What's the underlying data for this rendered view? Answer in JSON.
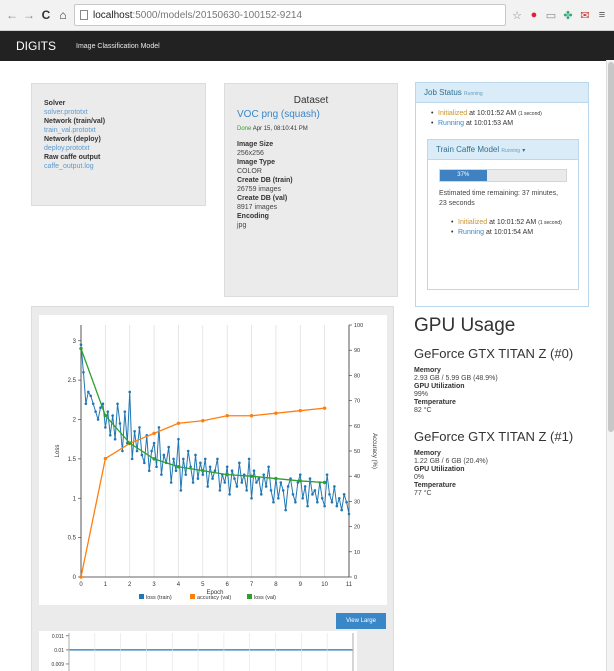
{
  "browser": {
    "url_host": "localhost",
    "url_path": ":5000/models/20150630-100152-9214",
    "back_icon": "back-arrow",
    "forward_icon": "forward-arrow",
    "reload_icon": "reload",
    "home_icon": "home"
  },
  "navbar": {
    "brand": "DIGITS",
    "crumb": "Image Classification Model"
  },
  "model_info": {
    "solver_label": "Solver",
    "solver_file": "solver.prototxt",
    "net_train_label": "Network (train/val)",
    "net_train_file": "train_val.prototxt",
    "net_deploy_label": "Network (deploy)",
    "net_deploy_file": "deploy.prototxt",
    "raw_label": "Raw caffe output",
    "raw_file": "caffe_output.log"
  },
  "dataset": {
    "heading": "Dataset",
    "name": "VOC png (squash)",
    "done_label": "Done",
    "done_time": "Apr 15, 08:10:41 PM",
    "image_size_label": "Image Size",
    "image_size": "256x256",
    "image_type_label": "Image Type",
    "image_type": "COLOR",
    "db_train_label": "Create DB (train)",
    "db_train": "26759 images",
    "db_val_label": "Create DB (val)",
    "db_val": "8917 images",
    "encoding_label": "Encoding",
    "encoding": "jpg"
  },
  "job_status": {
    "title": "Job Status",
    "state": "Running",
    "events": [
      {
        "status": "Initialized",
        "time": "at 10:01:52 AM",
        "note": "(1 second)"
      },
      {
        "status": "Running",
        "time": "at 10:01:53 AM",
        "note": ""
      }
    ],
    "model_title": "Train Caffe Model",
    "model_state": "Running",
    "progress_percent": 37,
    "progress_label": "37%",
    "estimate": "Estimated time remaining: 37 minutes, 23 seconds",
    "model_events": [
      {
        "status": "Initialized",
        "time": "at 10:01:52 AM",
        "note": "(1 second)"
      },
      {
        "status": "Running",
        "time": "at 10:01:54 AM",
        "note": ""
      }
    ]
  },
  "gpu": {
    "heading": "GPU Usage",
    "devices": [
      {
        "name": "GeForce GTX TITAN Z (#0)",
        "memory_label": "Memory",
        "memory": "2.93 GB / 5.99 GB (48.9%)",
        "util_label": "GPU Utilization",
        "util": "99%",
        "temp_label": "Temperature",
        "temp": "82 °C"
      },
      {
        "name": "GeForce GTX TITAN Z (#1)",
        "memory_label": "Memory",
        "memory": "1.22 GB / 6 GB (20.4%)",
        "util_label": "GPU Utilization",
        "util": "0%",
        "temp_label": "Temperature",
        "temp": "77 °C"
      }
    ]
  },
  "view_large_label": "View Large",
  "colors": {
    "loss_train": "#1f77b4",
    "accuracy_val": "#ff7f0e",
    "loss_val": "#2ca02c",
    "accent": "#3a87c8"
  },
  "chart_data": [
    {
      "type": "line",
      "xlabel": "Epoch",
      "ylabel": "Loss",
      "y2label": "Accuracy (%)",
      "xlim": [
        0,
        11
      ],
      "ylim": [
        0,
        3.2
      ],
      "y2lim": [
        0,
        100
      ],
      "xticks": [
        0,
        1,
        2,
        3,
        4,
        5,
        6,
        7,
        8,
        9,
        10,
        11
      ],
      "yticks": [
        0,
        0.5,
        1,
        1.5,
        2,
        2.5,
        3
      ],
      "y2ticks": [
        0,
        10,
        20,
        30,
        40,
        50,
        60,
        70,
        80,
        90,
        100
      ],
      "legend": "bottom",
      "series": [
        {
          "name": "loss (train)",
          "axis": "y",
          "color": "#1f77b4",
          "x": [
            0,
            0.1,
            0.2,
            0.3,
            0.4,
            0.5,
            0.6,
            0.7,
            0.8,
            0.9,
            1.0,
            1.1,
            1.2,
            1.3,
            1.4,
            1.5,
            1.6,
            1.7,
            1.8,
            1.9,
            2.0,
            2.1,
            2.2,
            2.3,
            2.4,
            2.5,
            2.6,
            2.7,
            2.8,
            2.9,
            3.0,
            3.1,
            3.2,
            3.3,
            3.4,
            3.5,
            3.6,
            3.7,
            3.8,
            3.9,
            4.0,
            4.1,
            4.2,
            4.3,
            4.4,
            4.5,
            4.6,
            4.7,
            4.8,
            4.9,
            5.0,
            5.1,
            5.2,
            5.3,
            5.4,
            5.5,
            5.6,
            5.7,
            5.8,
            5.9,
            6.0,
            6.1,
            6.2,
            6.3,
            6.4,
            6.5,
            6.6,
            6.7,
            6.8,
            6.9,
            7.0,
            7.1,
            7.2,
            7.3,
            7.4,
            7.5,
            7.6,
            7.7,
            7.8,
            7.9,
            8.0,
            8.1,
            8.2,
            8.3,
            8.4,
            8.5,
            8.6,
            8.7,
            8.8,
            8.9,
            9.0,
            9.1,
            9.2,
            9.3,
            9.4,
            9.5,
            9.6,
            9.7,
            9.8,
            9.9,
            10.0,
            10.1,
            10.2,
            10.3,
            10.4,
            10.5,
            10.6,
            10.7,
            10.8,
            10.9,
            11.0
          ],
          "y": [
            2.95,
            2.6,
            2.2,
            2.35,
            2.3,
            2.2,
            2.1,
            2.0,
            2.15,
            2.2,
            1.9,
            2.1,
            1.8,
            2.05,
            1.75,
            2.2,
            1.95,
            1.6,
            2.1,
            1.7,
            2.35,
            1.5,
            1.85,
            1.6,
            1.9,
            1.55,
            1.45,
            1.8,
            1.35,
            1.6,
            1.7,
            1.4,
            1.9,
            1.3,
            1.55,
            1.45,
            1.65,
            1.2,
            1.5,
            1.35,
            1.75,
            1.1,
            1.5,
            1.3,
            1.6,
            1.4,
            1.2,
            1.55,
            1.25,
            1.45,
            1.3,
            1.5,
            1.15,
            1.4,
            1.25,
            1.35,
            1.5,
            1.1,
            1.3,
            1.2,
            1.4,
            1.05,
            1.35,
            1.25,
            1.15,
            1.45,
            1.2,
            1.3,
            1.1,
            1.5,
            1.0,
            1.35,
            1.2,
            1.25,
            1.05,
            1.3,
            1.15,
            1.4,
            1.1,
            0.95,
            1.25,
            1.0,
            1.2,
            1.1,
            0.85,
            1.15,
            1.25,
            1.05,
            0.95,
            1.2,
            1.3,
            1.0,
            1.15,
            0.9,
            1.25,
            1.05,
            1.1,
            0.95,
            1.2,
            1.0,
            0.9,
            1.3,
            1.05,
            0.95,
            1.15,
            0.9,
            1.0,
            0.85,
            1.05,
            0.95,
            0.8
          ]
        },
        {
          "name": "accuracy (val)",
          "axis": "y2",
          "color": "#ff7f0e",
          "x": [
            0,
            1,
            2,
            3,
            4,
            5,
            6,
            7,
            8,
            9,
            10
          ],
          "y": [
            0,
            47,
            53,
            57,
            61,
            62,
            64,
            64,
            65,
            66,
            67
          ]
        },
        {
          "name": "loss (val)",
          "axis": "y",
          "color": "#2ca02c",
          "x": [
            0,
            1,
            2,
            3,
            4,
            5,
            6,
            7,
            8,
            9,
            10
          ],
          "y": [
            2.9,
            2.05,
            1.7,
            1.5,
            1.4,
            1.35,
            1.3,
            1.28,
            1.25,
            1.22,
            1.2
          ]
        }
      ]
    },
    {
      "type": "line",
      "yticks": [
        0.009,
        0.01,
        0.011
      ],
      "ylim": [
        0.0085,
        0.0112
      ],
      "series": [
        {
          "name": "",
          "values": [
            0.01,
            0.01,
            0.01,
            0.01,
            0.01,
            0.01,
            0.01,
            0.01,
            0.01,
            0.01,
            0.01,
            0.01
          ]
        }
      ]
    }
  ]
}
